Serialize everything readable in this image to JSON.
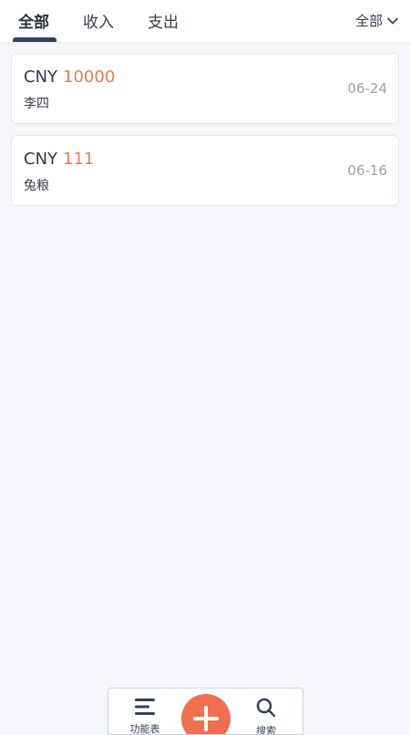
{
  "tabs": [
    {
      "label": "全部",
      "active": true
    },
    {
      "label": "收入",
      "active": false
    },
    {
      "label": "支出",
      "active": false
    }
  ],
  "filter": {
    "label": "全部",
    "icon": "chevron-down-icon"
  },
  "records": [
    {
      "currency": "CNY",
      "amount": "10000",
      "name": "李四",
      "date": "06-24"
    },
    {
      "currency": "CNY",
      "amount": "111",
      "name": "兔粮",
      "date": "06-16"
    }
  ],
  "bottom_nav": {
    "menu_label": "功能表",
    "search_label": "搜索",
    "add_icon": "plus-icon",
    "menu_icon": "menu-icon",
    "search_icon": "search-icon"
  },
  "colors": {
    "accent": "#ef6f4f",
    "amount": "#e87b55",
    "tab_indicator": "#364252",
    "background": "#f4f6fa"
  }
}
